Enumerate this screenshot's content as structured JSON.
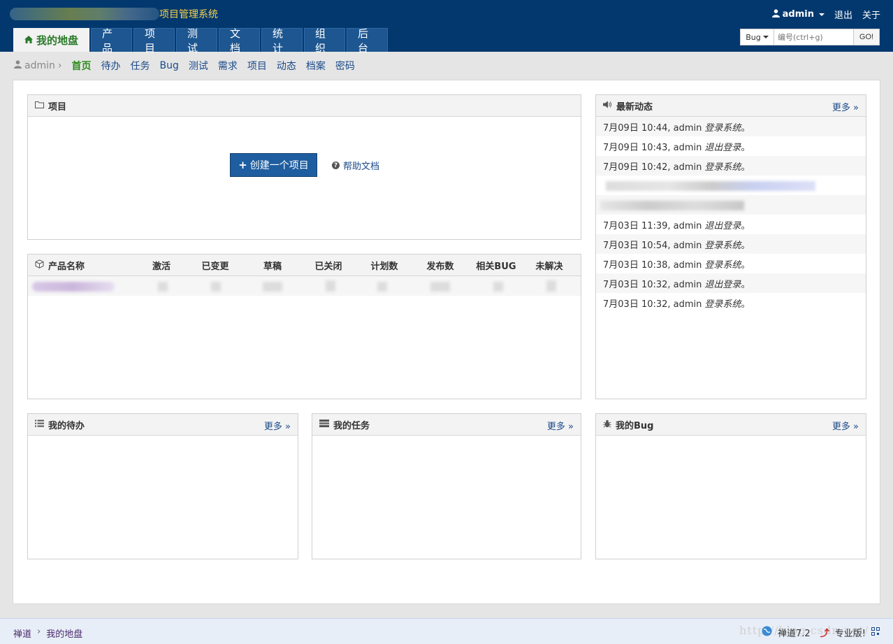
{
  "header": {
    "app_title": "项目管理系统",
    "user": "admin",
    "logout": "退出",
    "about": "关于"
  },
  "mainnav": [
    {
      "label": "我的地盘",
      "active": true
    },
    {
      "label": "产品"
    },
    {
      "label": "项目"
    },
    {
      "label": "测试"
    },
    {
      "label": "文档"
    },
    {
      "label": "统计"
    },
    {
      "label": "组织"
    },
    {
      "label": "后台"
    }
  ],
  "search": {
    "type": "Bug",
    "placeholder": "编号(ctrl+g)",
    "go": "GO!"
  },
  "subnav": {
    "user": "admin",
    "items": [
      "首页",
      "待办",
      "任务",
      "Bug",
      "测试",
      "需求",
      "项目",
      "动态",
      "档案",
      "密码"
    ]
  },
  "project_panel": {
    "title": "项目",
    "create_label": "创建一个项目",
    "help_label": "帮助文档"
  },
  "product_panel": {
    "columns": [
      "产品名称",
      "激活",
      "已变更",
      "草稿",
      "已关闭",
      "计划数",
      "发布数",
      "相关BUG",
      "未解决"
    ]
  },
  "dynamic_panel": {
    "title": "最新动态",
    "more": "更多",
    "items": [
      {
        "time": "7月09日 10:44, admin",
        "action": "登录系统",
        "end": "。"
      },
      {
        "time": "7月09日 10:43, admin",
        "action": "退出登录",
        "end": "。"
      },
      {
        "time": "7月09日 10:42, admin",
        "action": "登录系统",
        "end": "。"
      },
      {
        "blurred": true
      },
      {
        "blurred": true
      },
      {
        "time": "7月03日 11:39, admin",
        "action": "退出登录",
        "end": "。"
      },
      {
        "time": "7月03日 10:54, admin",
        "action": "登录系统",
        "end": "。"
      },
      {
        "time": "7月03日 10:38, admin",
        "action": "登录系统",
        "end": "。"
      },
      {
        "time": "7月03日 10:32, admin",
        "action": "退出登录",
        "end": "。"
      },
      {
        "time": "7月03日 10:32, admin",
        "action": "登录系统",
        "end": "。"
      }
    ]
  },
  "todo_panel": {
    "title": "我的待办",
    "more": "更多"
  },
  "task_panel": {
    "title": "我的任务",
    "more": "更多"
  },
  "bug_panel": {
    "title": "我的Bug",
    "more": "更多"
  },
  "footer": {
    "crumb1": "禅道",
    "crumb2": "我的地盘",
    "version": "禅道7.2",
    "pro": "专业版!",
    "watermark": "http://blog.csdn.net/"
  },
  "colors": {
    "header_bg": "#03386e",
    "accent_green": "#2e8b1e",
    "link_blue": "#1a4a8a",
    "brand_yellow": "#f5d24a"
  }
}
